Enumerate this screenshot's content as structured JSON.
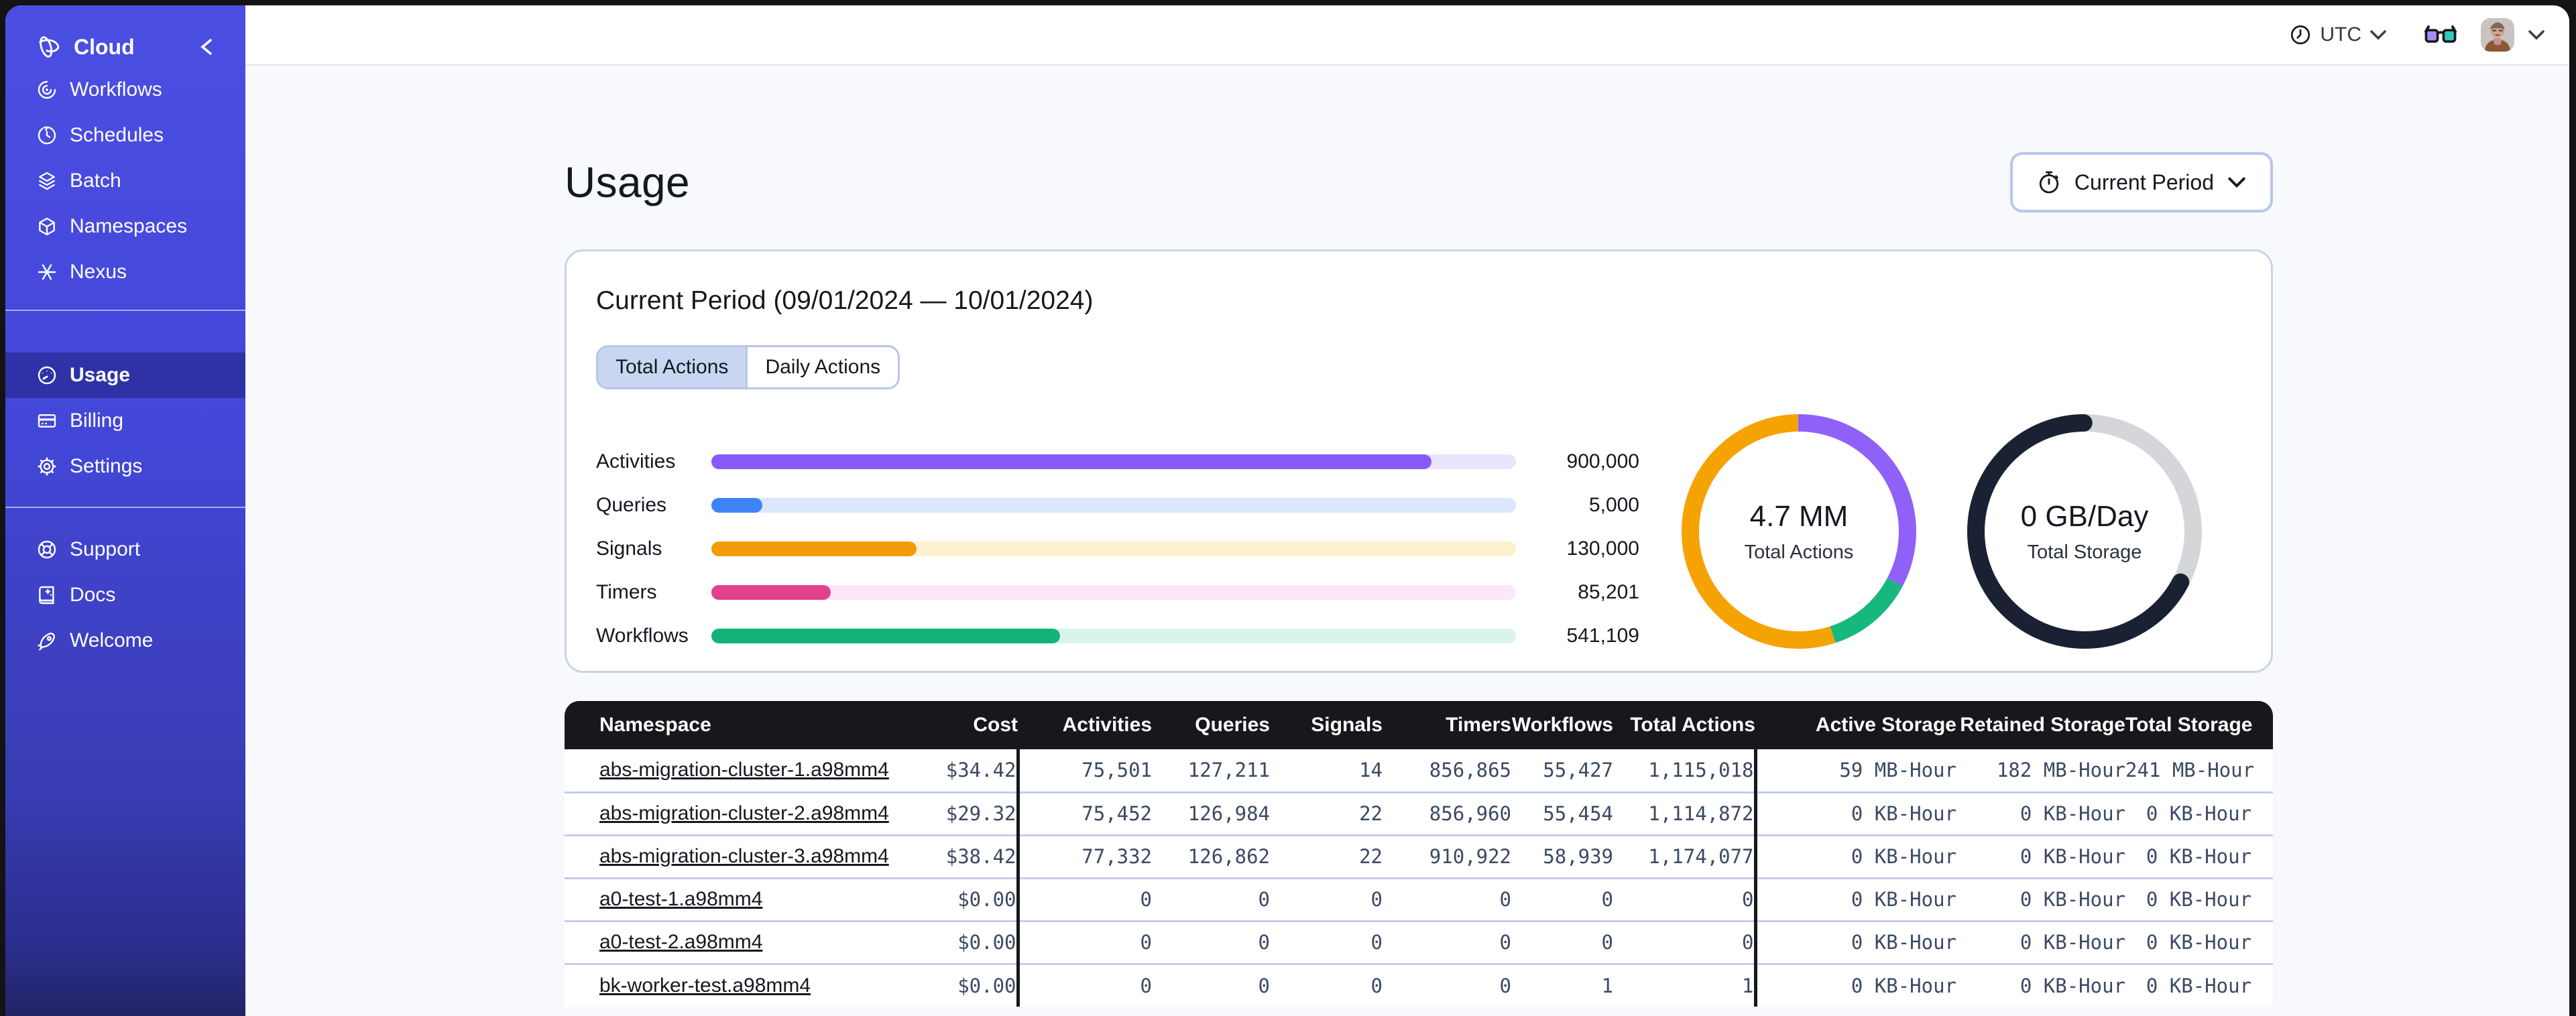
{
  "sidebar": {
    "brand": {
      "label": "Cloud",
      "icon": "temporal-logo-icon",
      "collapse_icon": "chevron-left-icon"
    },
    "groups": [
      {
        "items": [
          {
            "label": "Workflows",
            "icon": "workflows-icon"
          },
          {
            "label": "Schedules",
            "icon": "schedules-icon"
          },
          {
            "label": "Batch",
            "icon": "batch-icon"
          },
          {
            "label": "Namespaces",
            "icon": "namespaces-icon"
          },
          {
            "label": "Nexus",
            "icon": "nexus-icon"
          }
        ]
      },
      {
        "items": [
          {
            "label": "Usage",
            "icon": "usage-gauge-icon",
            "active": true
          },
          {
            "label": "Billing",
            "icon": "billing-card-icon"
          },
          {
            "label": "Settings",
            "icon": "settings-gear-icon"
          }
        ]
      },
      {
        "items": [
          {
            "label": "Support",
            "icon": "support-lifebuoy-icon"
          },
          {
            "label": "Docs",
            "icon": "docs-book-icon"
          },
          {
            "label": "Welcome",
            "icon": "welcome-rocket-icon"
          }
        ]
      }
    ]
  },
  "topbar": {
    "timezone": {
      "label": "UTC",
      "icon": "clock-icon",
      "chevron": "chevron-down-icon"
    },
    "labs_icon": "glasses-icon",
    "avatar": "user-avatar",
    "account_chevron": "chevron-down-icon"
  },
  "page": {
    "title": "Usage",
    "period_button": {
      "label": "Current Period",
      "icon": "stopwatch-icon",
      "chevron": "chevron-down-icon"
    }
  },
  "card": {
    "title": "Current Period (09/01/2024 — 10/01/2024)",
    "tabs": [
      {
        "label": "Total Actions",
        "active": true
      },
      {
        "label": "Daily Actions",
        "active": false
      }
    ]
  },
  "chart_data": [
    {
      "type": "bar",
      "orientation": "horizontal",
      "categories": [
        "Activities",
        "Queries",
        "Signals",
        "Timers",
        "Workflows"
      ],
      "values": [
        900000,
        5000,
        130000,
        85201,
        541109
      ],
      "value_labels": [
        "900,000",
        "5,000",
        "130,000",
        "85,201",
        "541,109"
      ],
      "bar_colors": [
        "#875bf7",
        "#3f83f8",
        "#f29b0b",
        "#e2418f",
        "#12b279"
      ],
      "track_colors": [
        "#ebe4fc",
        "#dbe7fb",
        "#fcf0cd",
        "#fce7f8",
        "#d9f5ea"
      ],
      "fill_fractions": [
        0.895,
        0.063,
        0.255,
        0.148,
        0.433
      ],
      "title": "",
      "xlabel": "",
      "ylabel": ""
    },
    {
      "type": "donut",
      "center_value": "4.7 MM",
      "center_label": "Total Actions",
      "segments": [
        {
          "color": "#9061f9",
          "start_deg": 0,
          "sweep_deg": 118
        },
        {
          "color": "#17b87e",
          "start_deg": 118,
          "sweep_deg": 44
        },
        {
          "color": "#f5a302",
          "start_deg": 162,
          "sweep_deg": 198
        }
      ]
    },
    {
      "type": "donut",
      "center_value": "0 GB/Day",
      "center_label": "Total Storage",
      "segments": [
        {
          "color": "#d5d6da",
          "start_deg": 0,
          "sweep_deg": 360
        },
        {
          "color": "#1a2133",
          "start_deg": 118,
          "sweep_deg": 242,
          "linecap": "round"
        }
      ]
    }
  ],
  "table": {
    "headers": [
      "Namespace",
      "Cost",
      "Activities",
      "Queries",
      "Signals",
      "Timers",
      "Workflows",
      "Total Actions",
      "Active Storage",
      "Retained Storage",
      "Total Storage"
    ],
    "rows": [
      [
        "abs-migration-cluster-1.a98mm4",
        "$34.42",
        "75,501",
        "127,211",
        "14",
        "856,865",
        "55,427",
        "1,115,018",
        "59 MB-Hour",
        "182 MB-Hour",
        "241 MB-Hour"
      ],
      [
        "abs-migration-cluster-2.a98mm4",
        "$29.32",
        "75,452",
        "126,984",
        "22",
        "856,960",
        "55,454",
        "1,114,872",
        "0 KB-Hour",
        "0 KB-Hour",
        "0 KB-Hour"
      ],
      [
        "abs-migration-cluster-3.a98mm4",
        "$38.42",
        "77,332",
        "126,862",
        "22",
        "910,922",
        "58,939",
        "1,174,077",
        "0 KB-Hour",
        "0 KB-Hour",
        "0 KB-Hour"
      ],
      [
        "a0-test-1.a98mm4",
        "$0.00",
        "0",
        "0",
        "0",
        "0",
        "0",
        "0",
        "0 KB-Hour",
        "0 KB-Hour",
        "0 KB-Hour"
      ],
      [
        "a0-test-2.a98mm4",
        "$0.00",
        "0",
        "0",
        "0",
        "0",
        "0",
        "0",
        "0 KB-Hour",
        "0 KB-Hour",
        "0 KB-Hour"
      ],
      [
        "bk-worker-test.a98mm4",
        "$0.00",
        "0",
        "0",
        "0",
        "0",
        "1",
        "1",
        "0 KB-Hour",
        "0 KB-Hour",
        "0 KB-Hour"
      ]
    ]
  },
  "colors": {
    "sidebar_top": "#4b4ee2",
    "sidebar_bottom": "#212465",
    "accent_border": "#b9c6ee",
    "tab_active_bg": "#c8d6f2",
    "table_header_bg": "#17181c",
    "row_divider": "#c3cee8",
    "number_text": "#3c4963",
    "content_bg": "#f8f9fc"
  }
}
